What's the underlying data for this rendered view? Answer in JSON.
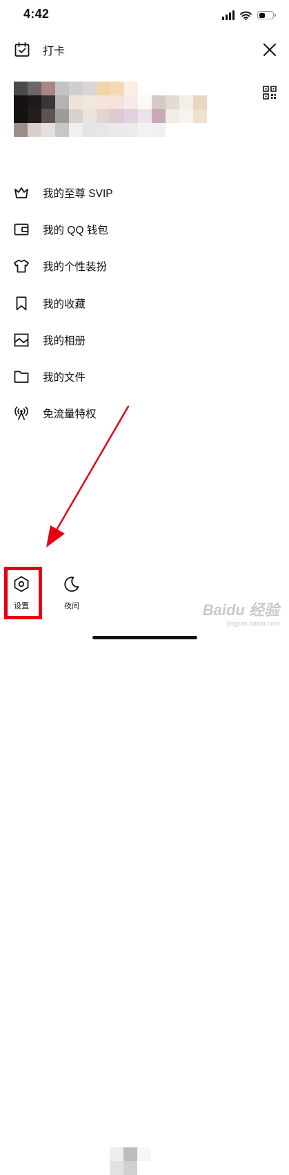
{
  "status_bar": {
    "time": "4:42",
    "battery_level": 0.45
  },
  "header": {
    "checkin_label": "打卡",
    "checkin_icon": "calendar-check-icon",
    "close_icon": "close-icon",
    "qr_icon": "qr-code-icon"
  },
  "menu": {
    "items": [
      {
        "label": "我的至尊 SVIP",
        "icon": "crown-icon"
      },
      {
        "label": "我的 QQ 钱包",
        "icon": "wallet-icon"
      },
      {
        "label": "我的个性装扮",
        "icon": "tshirt-icon"
      },
      {
        "label": "我的收藏",
        "icon": "bookmark-icon"
      },
      {
        "label": "我的相册",
        "icon": "photo-album-icon"
      },
      {
        "label": "我的文件",
        "icon": "folder-icon"
      },
      {
        "label": "免流量特权",
        "icon": "signal-tower-icon"
      }
    ]
  },
  "bottom": {
    "settings_label": "设置",
    "settings_icon": "gear-hexagon-icon",
    "night_label": "夜间",
    "night_icon": "moon-icon"
  },
  "colors": {
    "highlight": "#e60012",
    "text": "#111111",
    "watermark": "#c9c9c9"
  },
  "watermark": {
    "title": "Baidu 经验",
    "url": "jingyan.baidu.com"
  }
}
